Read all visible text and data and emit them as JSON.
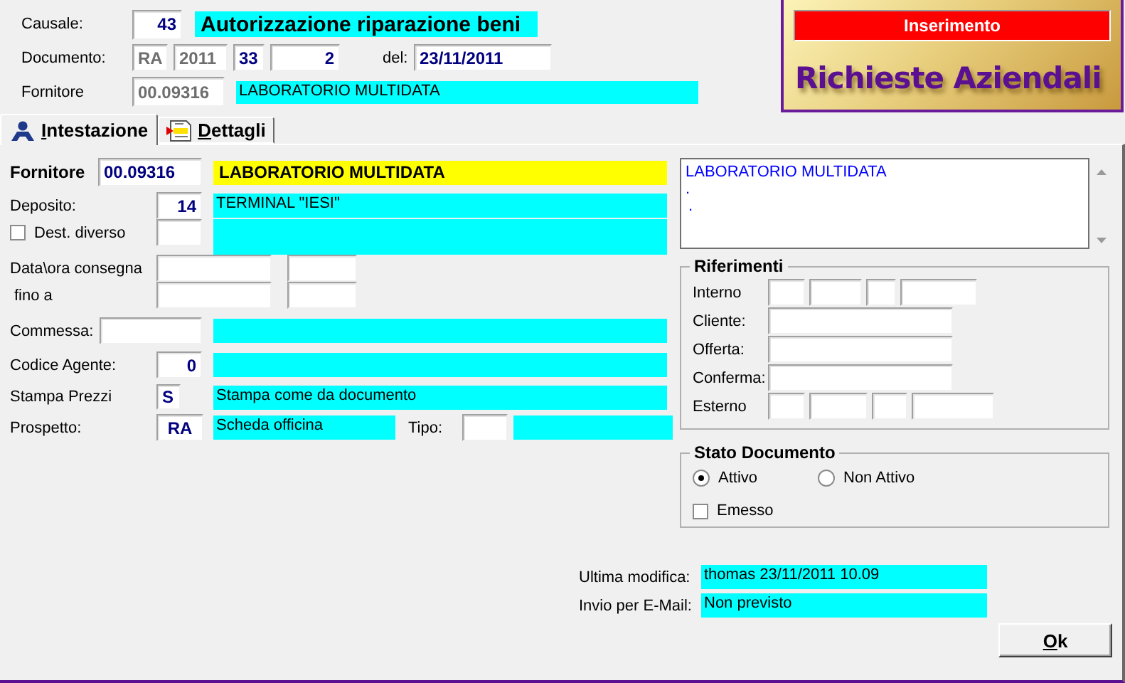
{
  "header": {
    "causale": {
      "label": "Causale:",
      "code": "43",
      "description": "Autorizzazione riparazione beni"
    },
    "documento": {
      "label": "Documento:",
      "parts": [
        {
          "value": "RA",
          "disabled": true
        },
        {
          "value": "2011",
          "disabled": true
        },
        {
          "value": "33",
          "disabled": false
        },
        {
          "value": "2",
          "disabled": false
        }
      ],
      "date_label": "del:",
      "date": "23/11/2011"
    },
    "fornitore": {
      "label": "Fornitore",
      "code": "00.09316",
      "disabled": true,
      "name": "LABORATORIO MULTIDATA"
    }
  },
  "banner": {
    "status": "Inserimento",
    "title": "Richieste Aziendali"
  },
  "tabs": [
    {
      "label": "Intestazione",
      "selected": true
    },
    {
      "label": "Dettagli",
      "selected": false
    }
  ],
  "intestazione": {
    "fornitore": {
      "label": "Fornitore",
      "code": "00.09316",
      "name": "LABORATORIO MULTIDATA"
    },
    "deposito": {
      "label": "Deposito:",
      "code": "14",
      "name": "TERMINAL \"IESI\""
    },
    "dest_diverso": {
      "label": "Dest. diverso",
      "checked": false
    },
    "consegna": {
      "label": "Data\\ora consegna",
      "until_label": "fino a"
    },
    "commessa": {
      "label": "Commessa:"
    },
    "codice_agente": {
      "label": "Codice Agente:",
      "code": "0"
    },
    "stampa_prezzi": {
      "label": "Stampa Prezzi",
      "code": "S",
      "description": "Stampa come da documento"
    },
    "prospetto": {
      "label": "Prospetto:",
      "code": "RA",
      "description": "Scheda officina",
      "tipo_label": "Tipo:"
    },
    "address_memo": {
      "lines": [
        "LABORATORIO MULTIDATA",
        ".",
        "."
      ]
    },
    "riferimenti": {
      "title": "Riferimenti",
      "rows": [
        {
          "label": "Interno",
          "kind": "split"
        },
        {
          "label": "Cliente:",
          "kind": "single"
        },
        {
          "label": "Offerta:",
          "kind": "single"
        },
        {
          "label": "Conferma:",
          "kind": "single"
        },
        {
          "label": "Esterno",
          "kind": "split_wide"
        }
      ]
    },
    "stato_documento": {
      "title": "Stato Documento",
      "options": [
        {
          "label": "Attivo",
          "selected": true
        },
        {
          "label": "Non Attivo",
          "selected": false
        }
      ],
      "emesso": {
        "label": "Emesso",
        "checked": false
      }
    },
    "info": [
      {
        "label": "Ultima modifica:",
        "value": "thomas 23/11/2011 10.09"
      },
      {
        "label": "Invio per E-Mail:",
        "value": "Non previsto"
      }
    ],
    "ok_button": "Ok"
  }
}
